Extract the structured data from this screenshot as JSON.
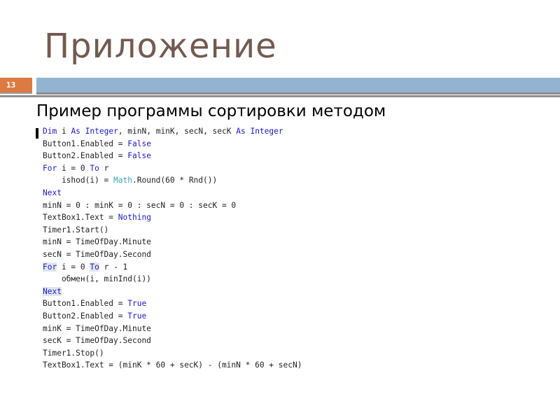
{
  "slide": {
    "title": "Приложение",
    "number": "13",
    "heading": "Пример программы сортировки методом",
    "colors": {
      "title": "#735a4f",
      "number_box": "#dd7a44",
      "bar": "#92b4d1",
      "rule": "#8e8e8e",
      "keyword": "#1b1bc4",
      "type": "#3aa7b5"
    }
  },
  "code": {
    "lines": [
      [
        {
          "t": "Dim",
          "c": "kw"
        },
        {
          "t": " i ",
          "c": "id"
        },
        {
          "t": "As",
          "c": "kw"
        },
        {
          "t": " ",
          "c": "id"
        },
        {
          "t": "Integer",
          "c": "kw"
        },
        {
          "t": ", minN, minK, secN, secK ",
          "c": "id"
        },
        {
          "t": "As",
          "c": "kw"
        },
        {
          "t": " ",
          "c": "id"
        },
        {
          "t": "Integer",
          "c": "kw"
        }
      ],
      [
        {
          "t": "Button1.Enabled = ",
          "c": "id"
        },
        {
          "t": "False",
          "c": "kw"
        }
      ],
      [
        {
          "t": "Button2.Enabled = ",
          "c": "id"
        },
        {
          "t": "False",
          "c": "kw"
        }
      ],
      [
        {
          "t": "For",
          "c": "kw"
        },
        {
          "t": " i = 0 ",
          "c": "id"
        },
        {
          "t": "To",
          "c": "kw"
        },
        {
          "t": " r",
          "c": "id"
        }
      ],
      [
        {
          "t": "    ishod(i) = ",
          "c": "id"
        },
        {
          "t": "Math",
          "c": "ty"
        },
        {
          "t": ".Round(60 * Rnd())",
          "c": "id"
        }
      ],
      [
        {
          "t": "Next",
          "c": "kw"
        }
      ],
      [
        {
          "t": "minN = 0 : minK = 0 : secN = 0 : secK = 0",
          "c": "id"
        }
      ],
      [
        {
          "t": "TextBox1.Text = ",
          "c": "id"
        },
        {
          "t": "Nothing",
          "c": "kw"
        }
      ],
      [
        {
          "t": "Timer1.Start()",
          "c": "id"
        }
      ],
      [
        {
          "t": "minN = TimeOfDay.Minute",
          "c": "id"
        }
      ],
      [
        {
          "t": "secN = TimeOfDay.Second",
          "c": "id"
        }
      ],
      [
        {
          "t": "For",
          "c": "kw hl"
        },
        {
          "t": " i = 0 ",
          "c": "id"
        },
        {
          "t": "To",
          "c": "kw hl"
        },
        {
          "t": " r - 1",
          "c": "id"
        }
      ],
      [
        {
          "t": "    обмен(i, minInd(i))",
          "c": "id"
        }
      ],
      [
        {
          "t": "Next",
          "c": "kw hl"
        }
      ],
      [
        {
          "t": "Button1.Enabled = ",
          "c": "id"
        },
        {
          "t": "True",
          "c": "kw"
        }
      ],
      [
        {
          "t": "Button2.Enabled = ",
          "c": "id"
        },
        {
          "t": "True",
          "c": "kw"
        }
      ],
      [
        {
          "t": "minK = TimeOfDay.Minute",
          "c": "id"
        }
      ],
      [
        {
          "t": "secK = TimeOfDay.Second",
          "c": "id"
        }
      ],
      [
        {
          "t": "Timer1.Stop()",
          "c": "id"
        }
      ],
      [
        {
          "t": "TextBox1.Text = (minK * 60 + secK) - (minN * 60 + secN)",
          "c": "id"
        }
      ]
    ]
  }
}
